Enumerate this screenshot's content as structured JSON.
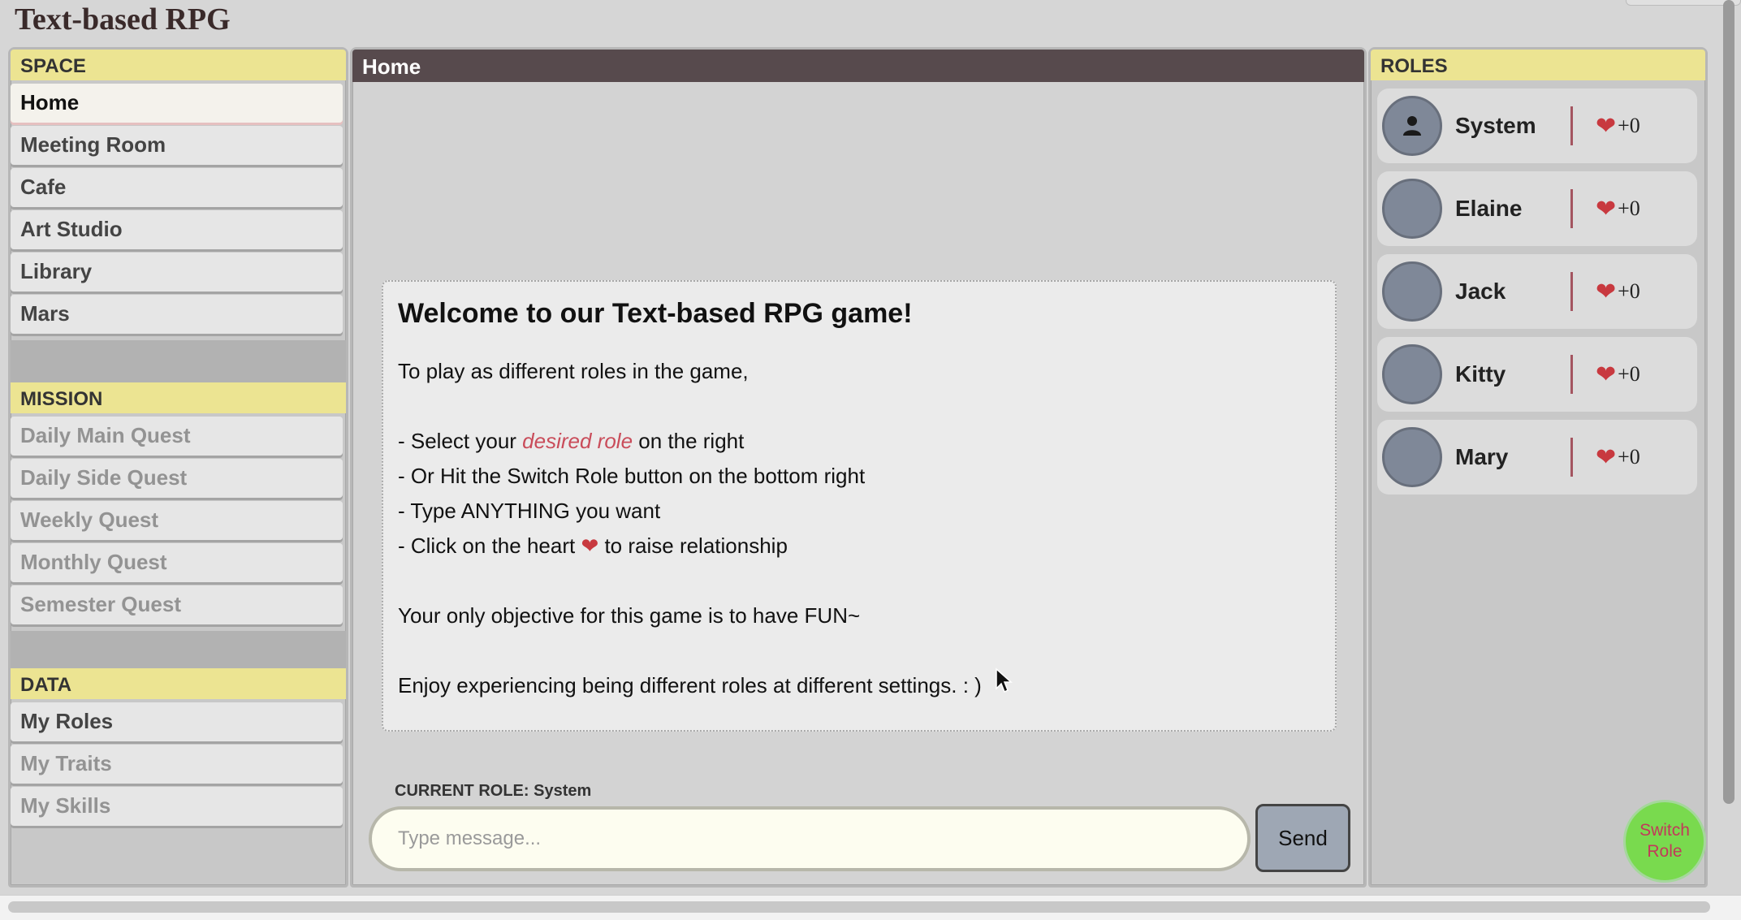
{
  "app_title": "Text-based RPG",
  "sidebar": {
    "space": {
      "header": "SPACE",
      "items": [
        {
          "label": "Home"
        },
        {
          "label": "Meeting Room"
        },
        {
          "label": "Cafe"
        },
        {
          "label": "Art Studio"
        },
        {
          "label": "Library"
        },
        {
          "label": "Mars"
        }
      ]
    },
    "mission": {
      "header": "MISSION",
      "items": [
        {
          "label": "Daily Main Quest"
        },
        {
          "label": "Daily Side Quest"
        },
        {
          "label": "Weekly Quest"
        },
        {
          "label": "Monthly Quest"
        },
        {
          "label": "Semester Quest"
        }
      ]
    },
    "data": {
      "header": "DATA",
      "items": [
        {
          "label": "My Roles"
        },
        {
          "label": "My Traits"
        },
        {
          "label": "My Skills"
        }
      ]
    }
  },
  "main": {
    "header": "Home",
    "welcome": {
      "title": "Welcome to our Text-based RPG game!",
      "intro": "To play as different roles in the game,",
      "step1_prefix": "- Select your ",
      "step1_highlight": "desired role",
      "step1_suffix": " on the right",
      "step2": "- Or Hit the Switch Role button on the bottom right",
      "step3": "- Type ANYTHING you want",
      "step4_prefix": "- Click on the heart ",
      "step4_suffix": " to raise relationship",
      "objective": "Your only objective for this game is to have FUN~",
      "closing": "Enjoy experiencing being different roles at different settings. : )"
    },
    "current_role_label": "CURRENT ROLE:",
    "current_role_value": "System",
    "input_placeholder": "Type message...",
    "send_label": "Send"
  },
  "roles": {
    "header": "ROLES",
    "items": [
      {
        "name": "System",
        "likes": "+0"
      },
      {
        "name": "Elaine",
        "likes": "+0"
      },
      {
        "name": "Jack",
        "likes": "+0"
      },
      {
        "name": "Kitty",
        "likes": "+0"
      },
      {
        "name": "Mary",
        "likes": "+0"
      }
    ],
    "switch_label_line1": "Switch",
    "switch_label_line2": "Role"
  },
  "colors": {
    "section_header_bg": "#ece492",
    "main_header_bg": "#574a4d",
    "heart": "#c8393f",
    "highlight_text": "#c94c5a",
    "switch_button_bg": "#79da4e",
    "avatar_bg": "#7f8898"
  },
  "icons": {
    "heart": "heart-icon",
    "system_avatar": "person-icon"
  }
}
